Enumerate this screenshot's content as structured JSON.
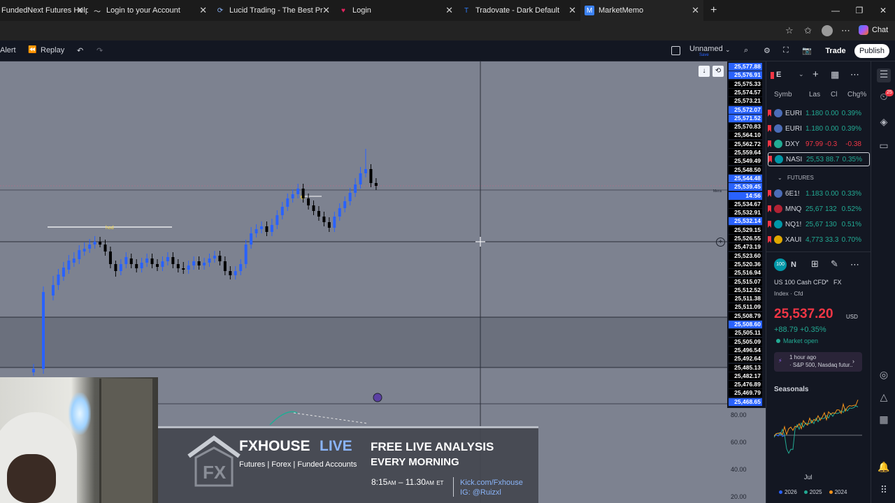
{
  "browser": {
    "tabs": [
      {
        "title": "FundedNext Futures Help",
        "icon_color": "#3a6fd8"
      },
      {
        "title": "Login to your Account",
        "icon_color": "#e6e6e6"
      },
      {
        "title": "Lucid Trading - The Best Prop Firm",
        "icon_color": "#8ab4f8"
      },
      {
        "title": "Login",
        "icon_color": "#e0245e"
      },
      {
        "title": "Tradovate - Dark Default",
        "icon_color": "#2e7bf6"
      },
      {
        "title": "MarketMemo",
        "icon_color": "#3b82f6"
      }
    ],
    "chat_label": "Chat"
  },
  "toolbar": {
    "alert_label": "Alert",
    "replay_label": "Replay",
    "layout_name": "Unnamed",
    "layout_sub": "Save",
    "trade_label": "Trade",
    "publish_label": "Publish"
  },
  "chart": {
    "price_labels": [
      {
        "text": "25,577.88",
        "style": "blue"
      },
      {
        "text": "25,576.91",
        "style": "blue"
      },
      {
        "text": "25,575.33",
        "style": "black"
      },
      {
        "text": "25,574.57",
        "style": "black"
      },
      {
        "text": "25,573.21",
        "style": "black"
      },
      {
        "text": "25,572.07",
        "style": "blue"
      },
      {
        "text": "25,571.52",
        "style": "blue"
      },
      {
        "text": "25,570.83",
        "style": "black"
      },
      {
        "text": "25,564.10",
        "style": "black"
      },
      {
        "text": "25,562.72",
        "style": "black"
      },
      {
        "text": "25,559.64",
        "style": "black"
      },
      {
        "text": "25,549.49",
        "style": "black"
      },
      {
        "text": "25,548.50",
        "style": "black"
      },
      {
        "text": "25,544.48",
        "style": "blue"
      },
      {
        "text": "25,539.45",
        "style": "blue"
      },
      {
        "text": "14:56",
        "style": "blue"
      },
      {
        "text": "25,534.67",
        "style": "black"
      },
      {
        "text": "25,532.91",
        "style": "black"
      },
      {
        "text": "25,532.14",
        "style": "blue"
      },
      {
        "text": "25,529.15",
        "style": "black"
      },
      {
        "text": "25,526.55",
        "style": "black"
      },
      {
        "text": "25,473.19",
        "style": "black"
      },
      {
        "text": "25,523.60",
        "style": "black"
      },
      {
        "text": "25,520.36",
        "style": "black"
      },
      {
        "text": "25,516.94",
        "style": "black"
      },
      {
        "text": "25,515.07",
        "style": "black"
      },
      {
        "text": "25,512.52",
        "style": "black"
      },
      {
        "text": "25,511.38",
        "style": "black"
      },
      {
        "text": "25,511.09",
        "style": "black"
      },
      {
        "text": "25,508.79",
        "style": "black"
      },
      {
        "text": "25,508.60",
        "style": "blue"
      },
      {
        "text": "25,505.11",
        "style": "black"
      },
      {
        "text": "25,505.09",
        "style": "black"
      },
      {
        "text": "25,496.54",
        "style": "black"
      },
      {
        "text": "25,492.64",
        "style": "black"
      },
      {
        "text": "25,485.13",
        "style": "black"
      },
      {
        "text": "25,482.17",
        "style": "black"
      },
      {
        "text": "25,476.89",
        "style": "black"
      },
      {
        "text": "25,469.79",
        "style": "black"
      },
      {
        "text": "25,468.65",
        "style": "blue"
      }
    ],
    "oscillator_labels": [
      "80.00",
      "60.00",
      "40.00",
      "20.00"
    ],
    "annotation_text": "hod",
    "line_label": "Mens"
  },
  "watchlist": {
    "title": "E",
    "columns": [
      "Symb",
      "Las",
      "Cl",
      "Chg%"
    ],
    "rows": [
      {
        "sym": "EURI",
        "last": "1.180",
        "chg": "0.00",
        "chgp": "0.39%",
        "dir": "pos",
        "icon_color": "#4b6cb7"
      },
      {
        "sym": "EURI",
        "last": "1.180",
        "chg": "0.00",
        "chgp": "0.39%",
        "dir": "pos",
        "icon_color": "#4b6cb7"
      },
      {
        "sym": "DXY",
        "last": "97.99",
        "chg": "-0.3",
        "chgp": "-0.38",
        "dir": "neg",
        "icon_color": "#22ab94"
      },
      {
        "sym": "NASI",
        "last": "25,53",
        "chg": "88.7",
        "chgp": "0.35%",
        "dir": "pos",
        "icon_color": "#0097a7"
      }
    ],
    "section_label": "FUTURES",
    "futures": [
      {
        "sym": "6E1!",
        "last": "1.183",
        "chg": "0.00",
        "chgp": "0.33%",
        "dir": "pos",
        "icon_color": "#4b6cb7"
      },
      {
        "sym": "MNQ",
        "last": "25,67",
        "chg": "132",
        "chgp": "0.52%",
        "dir": "pos",
        "icon_color": "#b22234"
      },
      {
        "sym": "NQ1!",
        "last": "25,67",
        "chg": "130",
        "chgp": "0.51%",
        "dir": "pos",
        "icon_color": "#0097a7"
      },
      {
        "sym": "XAUI",
        "last": "4,773",
        "chg": "33.3",
        "chgp": "0.70%",
        "dir": "pos",
        "icon_color": "#e0a800"
      }
    ]
  },
  "details": {
    "badge": "100",
    "symbol_short": "N",
    "name": "US 100 Cash CFD",
    "exchange": "FX",
    "type_line": "Index · Cfd",
    "price": "25,537.20",
    "currency": "USD",
    "change": "+88.79 +0.35%",
    "market_status": "Market open",
    "news_time": "1 hour ago",
    "news_text": "· S&P 500, Nasdaq futur...",
    "seasonals_title": "Seasonals",
    "seasonals_month": "Jul",
    "seasonals_legend": [
      {
        "year": "2026",
        "color": "#2962ff"
      },
      {
        "year": "2025",
        "color": "#22ab94"
      },
      {
        "year": "2024",
        "color": "#f7931a"
      }
    ]
  },
  "banner": {
    "brand_main": "FXHOUSE",
    "brand_live": "LIVE",
    "tagline": "Futures | Forex | Funded Accounts",
    "headline_1": "FREE LIVE ANALYSIS",
    "headline_2": "EVERY MORNING",
    "time_start": "8:15",
    "time_start_suffix": "AM",
    "time_end": "11.30",
    "time_end_suffix": "AM",
    "timezone": "ET",
    "link": "Kick.com/Fxhouse",
    "ig": "IG: @Ruizxl"
  },
  "colors": {
    "bull": "#2962ff",
    "bear": "#000000",
    "chart_bg": "#7d8290",
    "zone_bg": "#6b707d",
    "accent": "#2962ff"
  }
}
